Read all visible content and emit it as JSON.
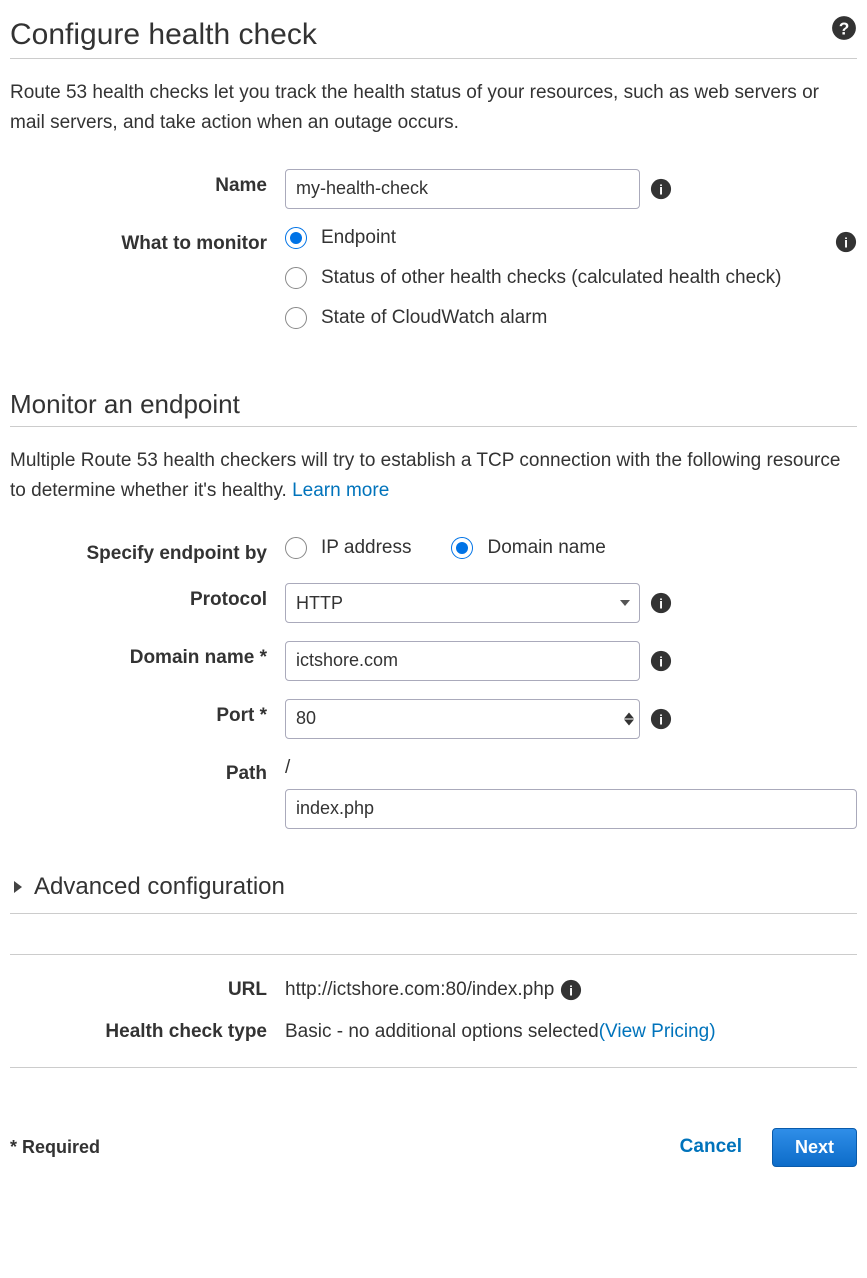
{
  "header": {
    "title": "Configure health check",
    "description": "Route 53 health checks let you track the health status of your resources, such as web servers or mail servers, and take action when an outage occurs."
  },
  "form": {
    "name_label": "Name",
    "name_value": "my-health-check",
    "monitor_label": "What to monitor",
    "monitor_options": {
      "endpoint": "Endpoint",
      "calculated": "Status of other health checks (calculated health check)",
      "cloudwatch": "State of CloudWatch alarm"
    }
  },
  "endpoint_section": {
    "title": "Monitor an endpoint",
    "description": "Multiple Route 53 health checkers will try to establish a TCP connection with the following resource to determine whether it's healthy. ",
    "learn_more": "Learn more",
    "specify_label": "Specify endpoint by",
    "specify_options": {
      "ip": "IP address",
      "domain": "Domain name"
    },
    "protocol_label": "Protocol",
    "protocol_value": "HTTP",
    "domain_label": "Domain name *",
    "domain_value": "ictshore.com",
    "port_label": "Port *",
    "port_value": "80",
    "path_label": "Path",
    "path_slash": "/",
    "path_value": "index.php"
  },
  "advanced": {
    "title": "Advanced configuration"
  },
  "summary": {
    "url_label": "URL",
    "url_value": "http://ictshore.com:80/index.php",
    "type_label": "Health check type",
    "type_value": "Basic - no additional options selected ",
    "pricing_link": "(View Pricing)"
  },
  "footer": {
    "required_note": "* Required",
    "cancel": "Cancel",
    "next": "Next"
  }
}
